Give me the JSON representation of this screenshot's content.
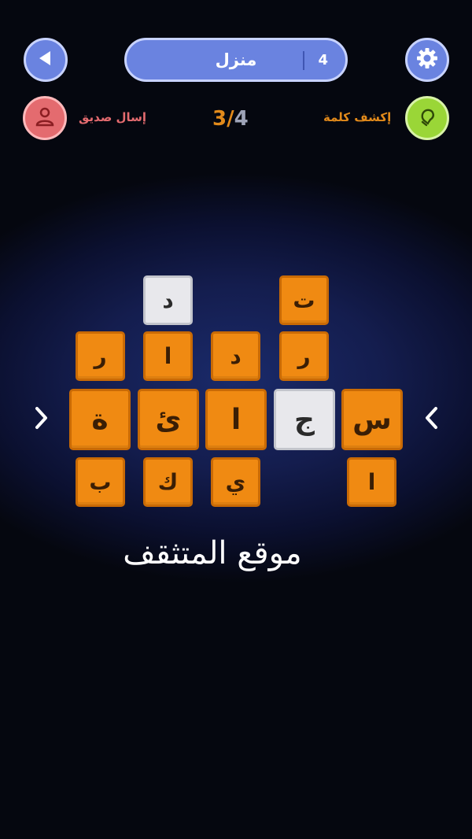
{
  "header": {
    "title": "منزل",
    "level": "4"
  },
  "actions": {
    "share_label": "إسال صديق",
    "hint_label": "إكشف كلمة"
  },
  "progress": {
    "current": "3",
    "total": "4"
  },
  "colors": {
    "button_blue": "#6a83e0",
    "button_red": "#e46b6f",
    "button_green": "#9ad637",
    "tile_orange": "#f08a12",
    "tile_revealed": "#e8e8ec"
  },
  "tiles": {
    "top_1": "د",
    "top_2": "ت",
    "row2_1": "ر",
    "row2_2": "ا",
    "row2_3": "د",
    "row2_4": "ر",
    "main_1": "ة",
    "main_2": "ئ",
    "main_3": "ا",
    "main_4": "ج",
    "main_5": "س",
    "row4_1": "ب",
    "row4_2": "ك",
    "row4_3": "ي",
    "row4_4": "ا"
  },
  "watermark": "موقع المتثقف"
}
